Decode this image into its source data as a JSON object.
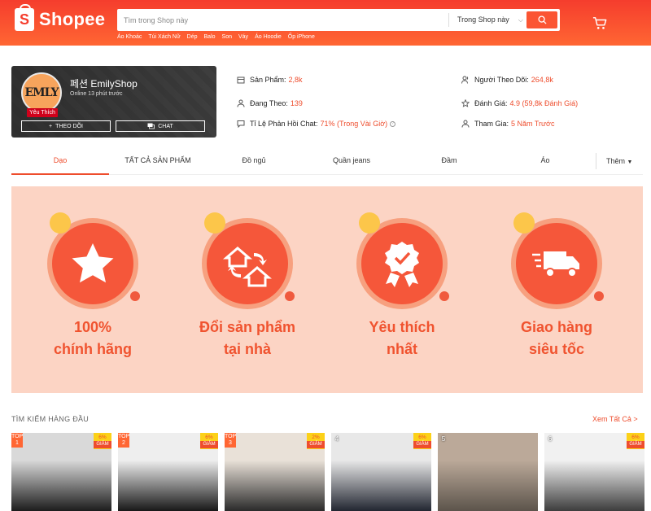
{
  "header": {
    "brand": "Shopee",
    "search_placeholder": "Tìm trong Shop này",
    "search_scope": "Trong Shop này",
    "keywords": [
      "Áo Khoác",
      "Túi Xách Nữ",
      "Dép",
      "Balo",
      "Son",
      "Váy",
      "Áo Hoodie",
      "Ốp iPhone"
    ]
  },
  "shop": {
    "avatar_text": "EMLY",
    "badge": "Yêu Thích",
    "name": "페션 EmilyShop",
    "online": "Online 13 phút trước",
    "follow_label": "THEO DÕI",
    "chat_label": "CHAT"
  },
  "stats": {
    "products_label": "Sản Phẩm:",
    "products_value": "2,8k",
    "following_label": "Đang Theo:",
    "following_value": "139",
    "chat_rate_label": "Tỉ Lệ Phản Hồi Chat:",
    "chat_rate_value": "71% (Trong Vài Giờ)",
    "followers_label": "Người Theo Dõi:",
    "followers_value": "264,8k",
    "rating_label": "Đánh Giá:",
    "rating_value": "4.9 (59,8k Đánh Giá)",
    "joined_label": "Tham Gia:",
    "joined_value": "5 Năm Trước"
  },
  "tabs": [
    "Dạo",
    "TẤT CẢ SẢN PHẨM",
    "Đồ ngủ",
    "Quần jeans",
    "Đầm",
    "Áo"
  ],
  "tab_more": "Thêm",
  "banner": {
    "features": [
      {
        "line1": "100%",
        "line2": "chính hãng",
        "icon": "star-icon"
      },
      {
        "line1": "Đổi sản phẩm",
        "line2": "tại nhà",
        "icon": "home-exchange-icon"
      },
      {
        "line1": "Yêu thích",
        "line2": "nhất",
        "icon": "award-badge-icon"
      },
      {
        "line1": "Giao hàng",
        "line2": "siêu tốc",
        "icon": "delivery-truck-icon"
      }
    ]
  },
  "top_search": {
    "title": "TÌM KIẾM HÀNG ĐẦU",
    "see_all": "Xem Tất Cả >",
    "items": [
      {
        "rank": "1",
        "top": "TOP",
        "discount": "6%",
        "discount_label": "GIẢM",
        "color_top": "#d9d9d9",
        "color_bottom": "#1c1c1c"
      },
      {
        "rank": "2",
        "top": "TOP",
        "discount": "6%",
        "discount_label": "GIẢM",
        "color_top": "#eeeeee",
        "color_bottom": "#181818"
      },
      {
        "rank": "3",
        "top": "TOP",
        "discount": "2%",
        "discount_label": "GIẢM",
        "color_top": "#e9e1d8",
        "color_bottom": "#2a2a2a"
      },
      {
        "rank": "4",
        "top": "",
        "discount": "6%",
        "discount_label": "GIẢM",
        "color_top": "#e8e8e8",
        "color_bottom": "#222631"
      },
      {
        "rank": "5",
        "top": "",
        "discount": "",
        "discount_label": "",
        "color_top": "#bba999",
        "color_bottom": "#5c544b"
      },
      {
        "rank": "6",
        "top": "",
        "discount": "6%",
        "discount_label": "GIẢM",
        "color_top": "#f1f1f1",
        "color_bottom": "#3d3d3d"
      }
    ]
  }
}
